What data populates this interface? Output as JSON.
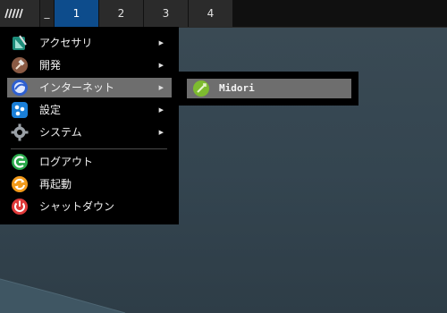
{
  "taskbar": {
    "menu_icon": "launcher-icon",
    "show_desktop_label": "_",
    "workspaces": [
      {
        "label": "1",
        "active": true
      },
      {
        "label": "2",
        "active": false
      },
      {
        "label": "3",
        "active": false
      },
      {
        "label": "4",
        "active": false
      }
    ]
  },
  "menu": {
    "items": [
      {
        "label": "アクセサリ",
        "icon": "accessories-icon",
        "submenu": true
      },
      {
        "label": "開発",
        "icon": "development-icon",
        "submenu": true
      },
      {
        "label": "インターネット",
        "icon": "internet-icon",
        "submenu": true,
        "highlighted": true
      },
      {
        "label": "設定",
        "icon": "settings-icon",
        "submenu": true
      },
      {
        "label": "システム",
        "icon": "system-icon",
        "submenu": true
      },
      {
        "label": "ログアウト",
        "icon": "logout-icon",
        "submenu": false
      },
      {
        "label": "再起動",
        "icon": "reboot-icon",
        "submenu": false
      },
      {
        "label": "シャットダウン",
        "icon": "shutdown-icon",
        "submenu": false
      }
    ],
    "arrow": "▶"
  },
  "submenu": {
    "items": [
      {
        "label": "Midori",
        "icon": "midori-browser-icon"
      }
    ]
  },
  "colors": {
    "taskbar_bg": "#101010",
    "active_workspace": "#0d4c8c",
    "menu_bg": "#000000",
    "highlight": "#6e6e6e",
    "desktop": "#344550"
  }
}
